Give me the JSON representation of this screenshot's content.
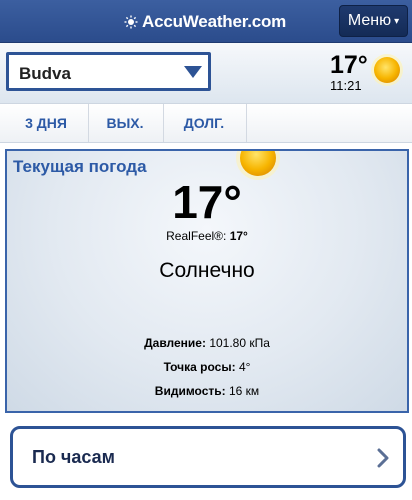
{
  "header": {
    "logo_text": "AccuWeather.com",
    "menu_label": "Меню",
    "menu_caret": "▾"
  },
  "location": {
    "selected": "Budva",
    "current_temp": "17°",
    "time": "11:21"
  },
  "tabs": [
    {
      "label": "3 ДНЯ"
    },
    {
      "label": "ВЫХ."
    },
    {
      "label": "ДОЛГ."
    }
  ],
  "current": {
    "title": "Текущая погода",
    "temperature": "17°",
    "realfeel_label": "RealFeel®:",
    "realfeel_value": "17°",
    "condition": "Солнечно",
    "pressure_label": "Давление:",
    "pressure_value": "101.80 кПа",
    "dewpoint_label": "Точка росы:",
    "dewpoint_value": "4°",
    "visibility_label": "Видимость:",
    "visibility_value": "16 км"
  },
  "hourly": {
    "label": "По часам"
  },
  "icons": {
    "logo": "sun-icon",
    "location_dropdown": "triangle-down-icon",
    "header_weather": "sun-icon",
    "panel_weather": "sun-icon",
    "hourly_chevron": "chevron-right-icon"
  },
  "colors": {
    "header_bg": "#2b4c8c",
    "accent_blue": "#2d5aa6",
    "sun": "#f7b500"
  }
}
